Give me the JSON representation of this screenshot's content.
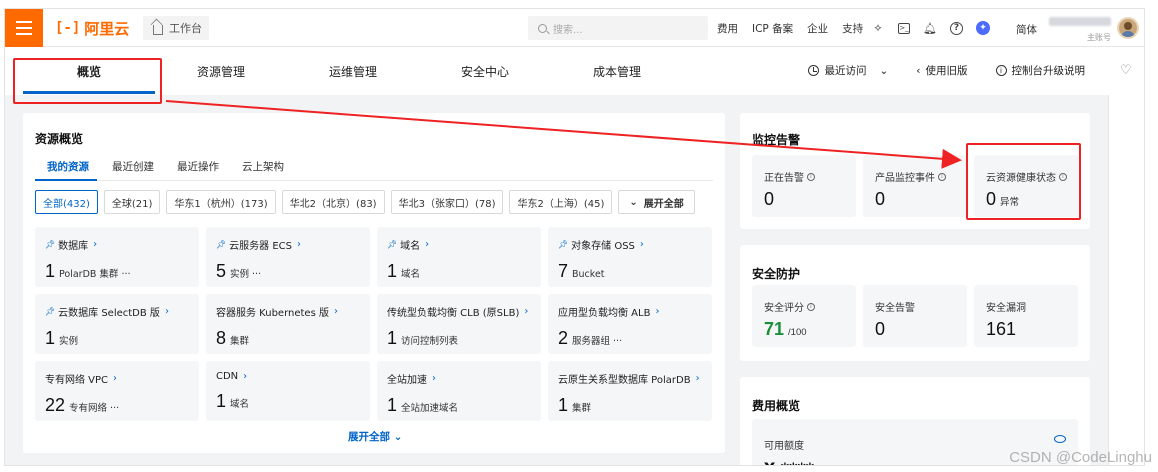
{
  "header": {
    "logo_text": "阿里云",
    "logo_mark": "[-]",
    "workbench_label": "工作台",
    "search_placeholder": "搜索...",
    "links": [
      "费用",
      "ICP 备案",
      "企业",
      "支持"
    ],
    "lang": "简体",
    "account_role": "主账号"
  },
  "nav": {
    "tabs": [
      "概览",
      "资源管理",
      "运维管理",
      "安全中心",
      "成本管理"
    ],
    "recent": "最近访问",
    "old_version": "使用旧版",
    "upgrade_note": "控制台升级说明"
  },
  "resources": {
    "title": "资源概览",
    "subtabs": [
      "我的资源",
      "最近创建",
      "最近操作",
      "云上架构"
    ],
    "filters": [
      "全部(432)",
      "全球(21)",
      "华东1（杭州）(173)",
      "华北2（北京）(83)",
      "华北3（张家口）(78)",
      "华东2（上海）(45)"
    ],
    "expand_filters": "展开全部",
    "items": [
      {
        "name": "数据库",
        "pinned": true,
        "count": "1",
        "unit": "PolarDB 集群 ···"
      },
      {
        "name": "云服务器 ECS",
        "pinned": true,
        "count": "5",
        "unit": "实例 ···"
      },
      {
        "name": "域名",
        "pinned": true,
        "count": "1",
        "unit": "域名"
      },
      {
        "name": "对象存储 OSS",
        "pinned": true,
        "count": "7",
        "unit": "Bucket"
      },
      {
        "name": "云数据库 SelectDB 版",
        "pinned": true,
        "count": "1",
        "unit": "实例"
      },
      {
        "name": "容器服务 Kubernetes 版",
        "pinned": false,
        "count": "8",
        "unit": "集群"
      },
      {
        "name": "传统型负载均衡 CLB (原SLB)",
        "pinned": false,
        "count": "1",
        "unit": "访问控制列表"
      },
      {
        "name": "应用型负载均衡 ALB",
        "pinned": false,
        "count": "2",
        "unit": "服务器组 ···"
      },
      {
        "name": "专有网络 VPC",
        "pinned": false,
        "count": "22",
        "unit": "专有网络 ···"
      },
      {
        "name": "CDN",
        "pinned": false,
        "count": "1",
        "unit": "域名"
      },
      {
        "name": "全站加速",
        "pinned": false,
        "count": "1",
        "unit": "全站加速域名"
      },
      {
        "name": "云原生关系型数据库 PolarDB",
        "pinned": false,
        "count": "1",
        "unit": "集群"
      }
    ],
    "expand_all": "展开全部"
  },
  "monitor": {
    "title": "监控告警",
    "stats": [
      {
        "label": "正在告警",
        "value": "0",
        "suffix": ""
      },
      {
        "label": "产品监控事件",
        "value": "0",
        "suffix": ""
      },
      {
        "label": "云资源健康状态",
        "value": "0",
        "suffix": "异常"
      }
    ]
  },
  "security": {
    "title": "安全防护",
    "stats": [
      {
        "label": "安全评分",
        "value": "71",
        "suffix": "/100"
      },
      {
        "label": "安全告警",
        "value": "0",
        "suffix": ""
      },
      {
        "label": "安全漏洞",
        "value": "161",
        "suffix": ""
      }
    ]
  },
  "fees": {
    "title": "费用概览",
    "available_label": "可用额度",
    "available_value": "¥ ****"
  },
  "watermark": "CSDN @CodeLinghu",
  "colors": {
    "brand": "#ff6a00",
    "accent": "#0064c8",
    "annotation": "#ee2222",
    "score": "#1a8f3a"
  }
}
